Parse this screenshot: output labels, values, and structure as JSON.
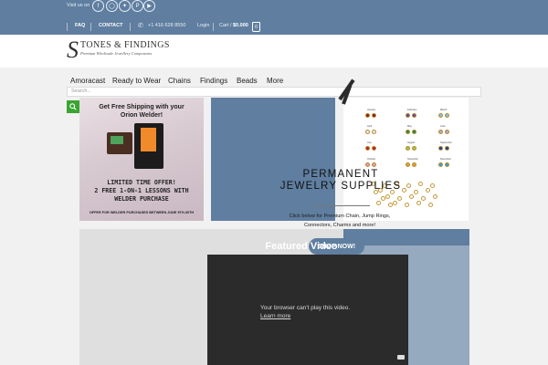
{
  "topbar": {
    "visit_label": "Visit us on",
    "social_icons": [
      "facebook-icon",
      "instagram-icon",
      "twitter-icon",
      "pinterest-icon",
      "youtube-icon"
    ],
    "nav": {
      "faq": "FAQ",
      "contact": "CONTACT"
    },
    "phone": "+1 416 628 8550",
    "login": "Login",
    "cart_label": "Cart /",
    "cart_total": "$0.000",
    "cart_count": "0",
    "bg_color": "#5f7ea0"
  },
  "logo": {
    "initial": "S",
    "name": "TONES & FINDINGS",
    "tagline": "Premium Wholesale Jewellery Components"
  },
  "menu": {
    "items": [
      "Amoracast",
      "Ready to Wear",
      "Chains",
      "Findings",
      "Beads",
      "More"
    ]
  },
  "search": {
    "placeholder": "Search..."
  },
  "promo_welder": {
    "headline_1": "Get Free Shipping with your",
    "headline_2": "Orion Welder!",
    "offer_1": "LIMITED TIME OFFER!",
    "offer_2": "2 FREE 1-ON-1 LESSONS WITH",
    "offer_3": "WELDER PURCHASE",
    "fineprint": "OFFER FOR WELDER PURCHASES BETWEEN JUNE 9TH-30TH"
  },
  "permanent": {
    "title_1": "PERMANENT",
    "title_2": "JEWELRY SUPPLIES",
    "subtitle_1": "Click below for Premium Chain, Jump Rings,",
    "subtitle_2": "Connectors, Charms and more!"
  },
  "birthstones": {
    "months": [
      "January",
      "February",
      "March",
      "April",
      "May",
      "June",
      "July",
      "August",
      "September",
      "October",
      "November",
      "December"
    ]
  },
  "featured": {
    "shop_button": "SHOP NOW!",
    "title": "Featured Video",
    "video_message": "Your browser can't play this video.",
    "video_link": "Learn more"
  }
}
